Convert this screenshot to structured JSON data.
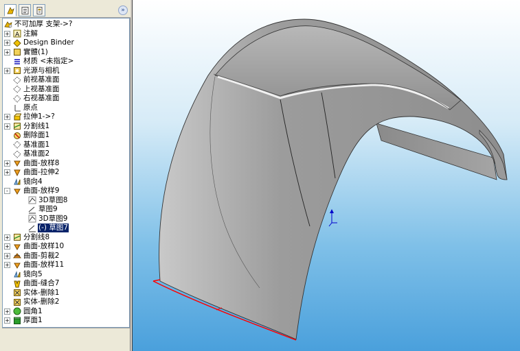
{
  "tree": {
    "root_label": "不可加厚 支架->?",
    "items": [
      {
        "label": "注解",
        "icon": "annotations-icon",
        "expander": "+"
      },
      {
        "label": "Design Binder",
        "icon": "design-binder-icon",
        "expander": "+"
      },
      {
        "label": "實體(1)",
        "icon": "solid-bodies-icon",
        "expander": "+"
      },
      {
        "label": "材质 <未指定>",
        "icon": "material-icon",
        "expander": ""
      },
      {
        "label": "光源与相机",
        "icon": "lights-cameras-icon",
        "expander": "+"
      },
      {
        "label": "前视基准面",
        "icon": "plane-icon",
        "expander": ""
      },
      {
        "label": "上视基准面",
        "icon": "plane-icon",
        "expander": ""
      },
      {
        "label": "右视基准面",
        "icon": "plane-icon",
        "expander": ""
      },
      {
        "label": "原点",
        "icon": "origin-icon",
        "expander": ""
      },
      {
        "label": "拉伸1->?",
        "icon": "extrude-icon",
        "expander": "+"
      },
      {
        "label": "分割线1",
        "icon": "split-line-icon",
        "expander": "+"
      },
      {
        "label": "删除面1",
        "icon": "delete-face-icon",
        "expander": ""
      },
      {
        "label": "基准面1",
        "icon": "plane-icon",
        "expander": ""
      },
      {
        "label": "基准面2",
        "icon": "plane-icon",
        "expander": ""
      },
      {
        "label": "曲面-放样8",
        "icon": "surface-loft-icon",
        "expander": "+"
      },
      {
        "label": "曲面-拉伸2",
        "icon": "surface-extrude-icon",
        "expander": "+"
      },
      {
        "label": "镜向4",
        "icon": "mirror-icon",
        "expander": ""
      },
      {
        "label": "曲面-放样9",
        "icon": "surface-loft-icon",
        "expander": "-"
      },
      {
        "label": "3D草图8",
        "icon": "3d-sketch-icon",
        "expander": "",
        "indent": 1
      },
      {
        "label": "草图9",
        "icon": "sketch-icon",
        "expander": "",
        "indent": 1
      },
      {
        "label": "3D草图9",
        "icon": "3d-sketch-icon",
        "expander": "",
        "indent": 1
      },
      {
        "label": "(-) 草图7",
        "icon": "sketch-icon",
        "expander": "",
        "indent": 1,
        "selected": true
      },
      {
        "label": "分割线8",
        "icon": "split-line-icon",
        "expander": "+"
      },
      {
        "label": "曲面-放样10",
        "icon": "surface-loft-icon",
        "expander": "+"
      },
      {
        "label": "曲面-剪裁2",
        "icon": "surface-trim-icon",
        "expander": "+"
      },
      {
        "label": "曲面-放样11",
        "icon": "surface-loft-icon",
        "expander": "+"
      },
      {
        "label": "镜向5",
        "icon": "mirror-icon",
        "expander": ""
      },
      {
        "label": "曲面-缝合7",
        "icon": "surface-knit-icon",
        "expander": ""
      },
      {
        "label": "实体-删除1",
        "icon": "delete-body-icon",
        "expander": ""
      },
      {
        "label": "实体-删除2",
        "icon": "delete-body-icon",
        "expander": ""
      },
      {
        "label": "圆角1",
        "icon": "fillet-icon",
        "expander": "+"
      },
      {
        "label": "厚面1",
        "icon": "thicken-icon",
        "expander": "+"
      }
    ]
  },
  "tabs": [
    {
      "name": "feature-manager-tab-icon"
    },
    {
      "name": "property-manager-tab-icon"
    },
    {
      "name": "configuration-manager-tab-icon"
    }
  ],
  "collapse_glyph": "»",
  "colors": {
    "selection": "#0a246a",
    "edge_highlight": "#ff0000",
    "model_fill": "#a8a8a8",
    "viewport_top": "#ffffff",
    "viewport_bottom": "#4aa0dc"
  }
}
